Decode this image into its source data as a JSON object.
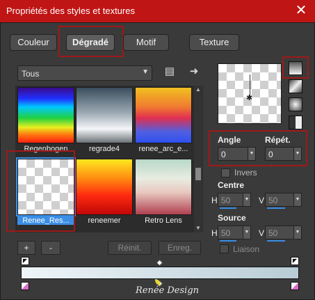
{
  "window": {
    "title": "Propriétés des styles et textures",
    "close_glyph": "✕"
  },
  "tabs": [
    {
      "label": "Couleur"
    },
    {
      "label": "Dégradé",
      "active": true
    },
    {
      "label": "Motif"
    },
    {
      "label": "Texture"
    }
  ],
  "category_select": {
    "value": "Tous"
  },
  "gallery": {
    "items": [
      {
        "label": "Regenbogen",
        "icon": "rainbow-gradient"
      },
      {
        "label": "regrade4",
        "icon": "steel-gradient"
      },
      {
        "label": "renee_arc_e...",
        "icon": "yellow-red-blue-gradient"
      },
      {
        "label": "Renee_Res...",
        "icon": "transparent-gradient",
        "selected": true
      },
      {
        "label": "reneemer",
        "icon": "red-yellow-gradient"
      },
      {
        "label": "Retro Lens",
        "icon": "retro-lens-gradient"
      }
    ]
  },
  "left_buttons": {
    "add": "+",
    "remove": "-",
    "reset": "Réinit.",
    "save": "Enreg."
  },
  "angle": {
    "label": "Angle",
    "value": "0"
  },
  "repeat": {
    "label": "Répét.",
    "value": "0"
  },
  "invert": {
    "label": "Invers"
  },
  "center": {
    "label": "Centre",
    "h_label": "H",
    "h_value": "50",
    "v_label": "V",
    "v_value": "50"
  },
  "source": {
    "label": "Source",
    "h_label": "H",
    "h_value": "50",
    "v_label": "V",
    "v_value": "50"
  },
  "link": {
    "label": "Liaison"
  },
  "watermark": {
    "text": "Renée Design"
  },
  "colors": {
    "title_bar": "#c01515",
    "selection": "#3a8ee6",
    "annotation": "#a01818"
  }
}
